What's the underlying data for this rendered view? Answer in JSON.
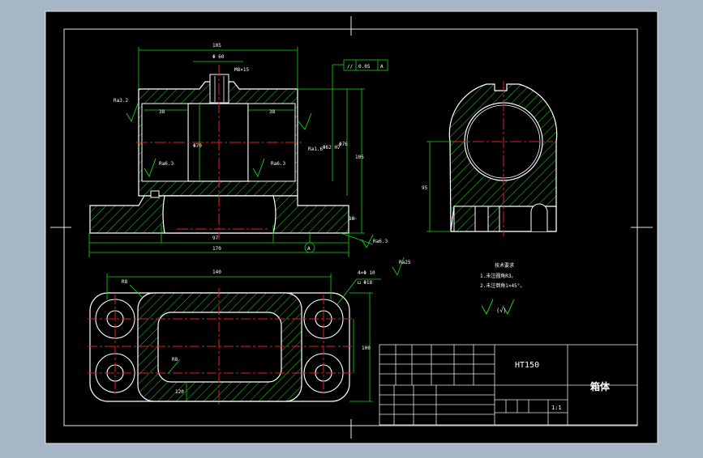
{
  "colors": {
    "background": "#a7b6c7",
    "sheet": "#000000",
    "outline": "#ffffff",
    "hatch": "#19d219",
    "centerline": "#e02020",
    "dimension": "#19d219",
    "text": "#ffffff"
  },
  "front_view": {
    "dims": {
      "top_width": "105",
      "slot_width": "Φ 60",
      "thread": "M8×15",
      "bore_left": "38",
      "bore_right": "38",
      "bore_dia": "Φ70",
      "height_inner": "Φ76",
      "height_total": "105",
      "fit": "Φ62 H7",
      "base_thickness": "18",
      "slot_length": "97",
      "base_length": "170"
    },
    "roughness": {
      "r1": "Ra3.2",
      "r2": "Ra6.3",
      "r3": "Ra6.3",
      "r4": "Ra1.6",
      "r5": "Ra6.3"
    },
    "tolerance_frame": {
      "symbol": "//",
      "value": "0.05",
      "datum": "A"
    },
    "datum_label": "A"
  },
  "side_view": {
    "dims": {
      "height": "95"
    }
  },
  "top_view": {
    "dims": {
      "length": "140",
      "corner": "R8",
      "holes": "4×Φ 10",
      "counterbore": "⊔ Φ18",
      "inner_r": "R8",
      "width": "100",
      "pocket": "120"
    },
    "roughness": "Ra25"
  },
  "notes": {
    "title": "技术要求",
    "line1": "1.未注圆角R3。",
    "line2": "2.未注倒角1×45°。",
    "roughness_other": "(√)"
  },
  "title_block": {
    "material": "HT150",
    "part_name": "箱体",
    "scale": "1:1"
  }
}
